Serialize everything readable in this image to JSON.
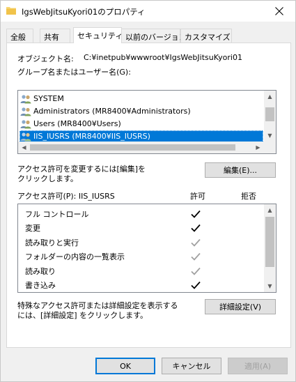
{
  "window": {
    "title": "IgsWebJitsuKyori01のプロパティ"
  },
  "tabs": [
    {
      "label": "全般"
    },
    {
      "label": "共有"
    },
    {
      "label": "セキュリティ"
    },
    {
      "label": "以前のバージョン"
    },
    {
      "label": "カスタマイズ"
    }
  ],
  "object": {
    "label": "オブジェクト名:",
    "value": "C:¥inetpub¥wwwroot¥IgsWebJitsuKyori01"
  },
  "groups_label": "グループ名またはユーザー名(G):",
  "users": [
    {
      "name": "SYSTEM"
    },
    {
      "name": "Administrators (MR8400¥Administrators)"
    },
    {
      "name": "Users (MR8400¥Users)"
    },
    {
      "name": "IIS_IUSRS (MR8400¥IIS_IUSRS)"
    }
  ],
  "edit_hint": {
    "line1": "アクセス許可を変更するには[編集]を",
    "line2": "クリックします。"
  },
  "edit_button": "編集(E)...",
  "permissions": {
    "header_label": "アクセス許可(P): IIS_IUSRS",
    "allow_label": "許可",
    "deny_label": "拒否",
    "rows": [
      {
        "label": "フル コントロール",
        "allow": "enabled"
      },
      {
        "label": "変更",
        "allow": "enabled"
      },
      {
        "label": "読み取りと実行",
        "allow": "inherited"
      },
      {
        "label": "フォルダーの内容の一覧表示",
        "allow": "inherited"
      },
      {
        "label": "読み取り",
        "allow": "inherited"
      },
      {
        "label": "書き込み",
        "allow": "enabled"
      }
    ]
  },
  "advanced_hint": {
    "line1": "特殊なアクセス許可または詳細設定を表示する",
    "line2": "には、[詳細設定] をクリックします。"
  },
  "advanced_button": "詳細設定(V)",
  "footer": {
    "ok": "OK",
    "cancel": "キャンセル",
    "apply": "適用(A)"
  },
  "colors": {
    "selection": "#0078d7",
    "check_enabled": "#000000",
    "check_inherited": "#a0a0a0"
  }
}
